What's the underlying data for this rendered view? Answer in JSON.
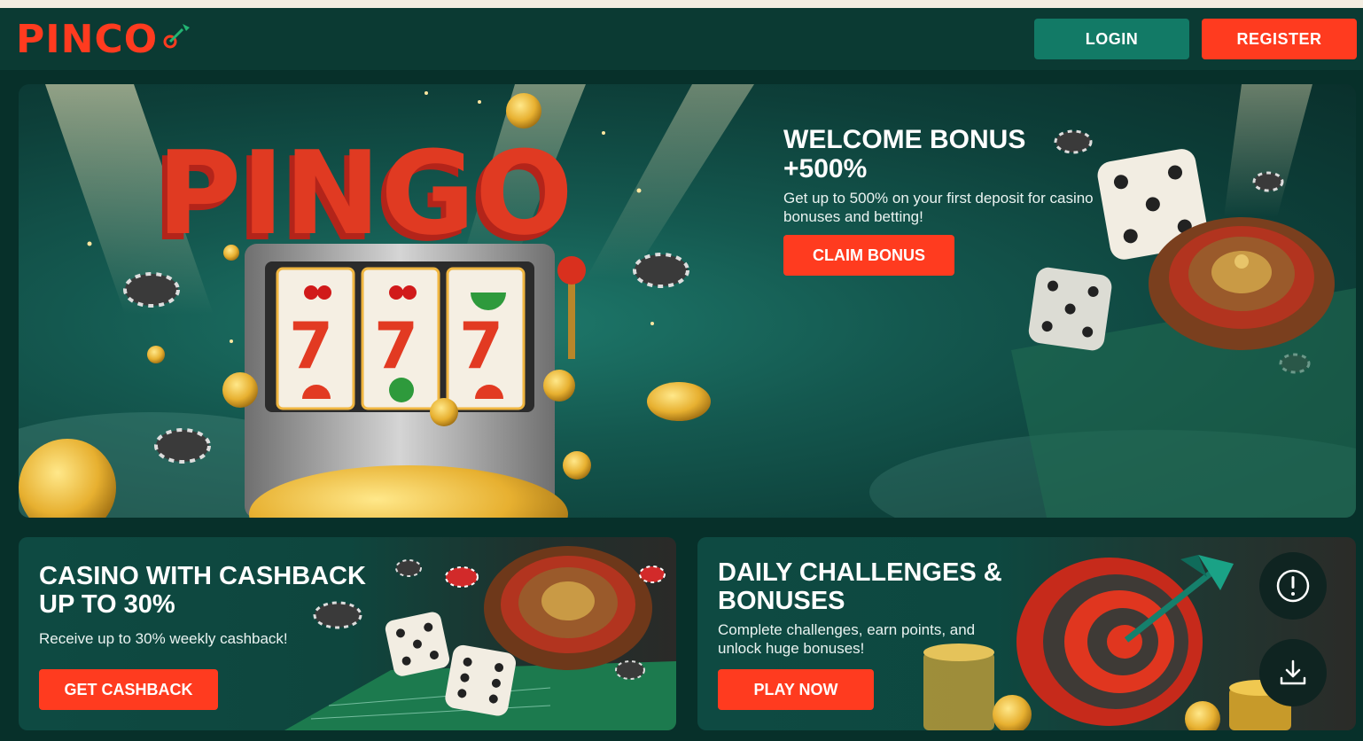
{
  "header": {
    "logo_text": "PINCO",
    "login_label": "LOGIN",
    "register_label": "REGISTER"
  },
  "hero": {
    "art_text": "PINGO",
    "title": "WELCOME BONUS +500%",
    "description": "Get up to 500% on your first deposit for casino bonuses and betting!",
    "button_label": "CLAIM BONUS"
  },
  "cards": [
    {
      "title": "CASINO WITH CASHBACK UP TO 30%",
      "description": "Receive up to 30% weekly cashback!",
      "button_label": "GET CASHBACK"
    },
    {
      "title": "DAILY CHALLENGES & BONUSES",
      "description": "Complete challenges, earn points, and unlock huge bonuses!",
      "button_label": "PLAY NOW"
    }
  ],
  "floating": {
    "info_icon": "info-icon",
    "download_icon": "download-icon"
  },
  "colors": {
    "brand": "#ff3b1f",
    "login_button": "#127a66",
    "background": "#07302a",
    "header": "#0b3a33"
  }
}
